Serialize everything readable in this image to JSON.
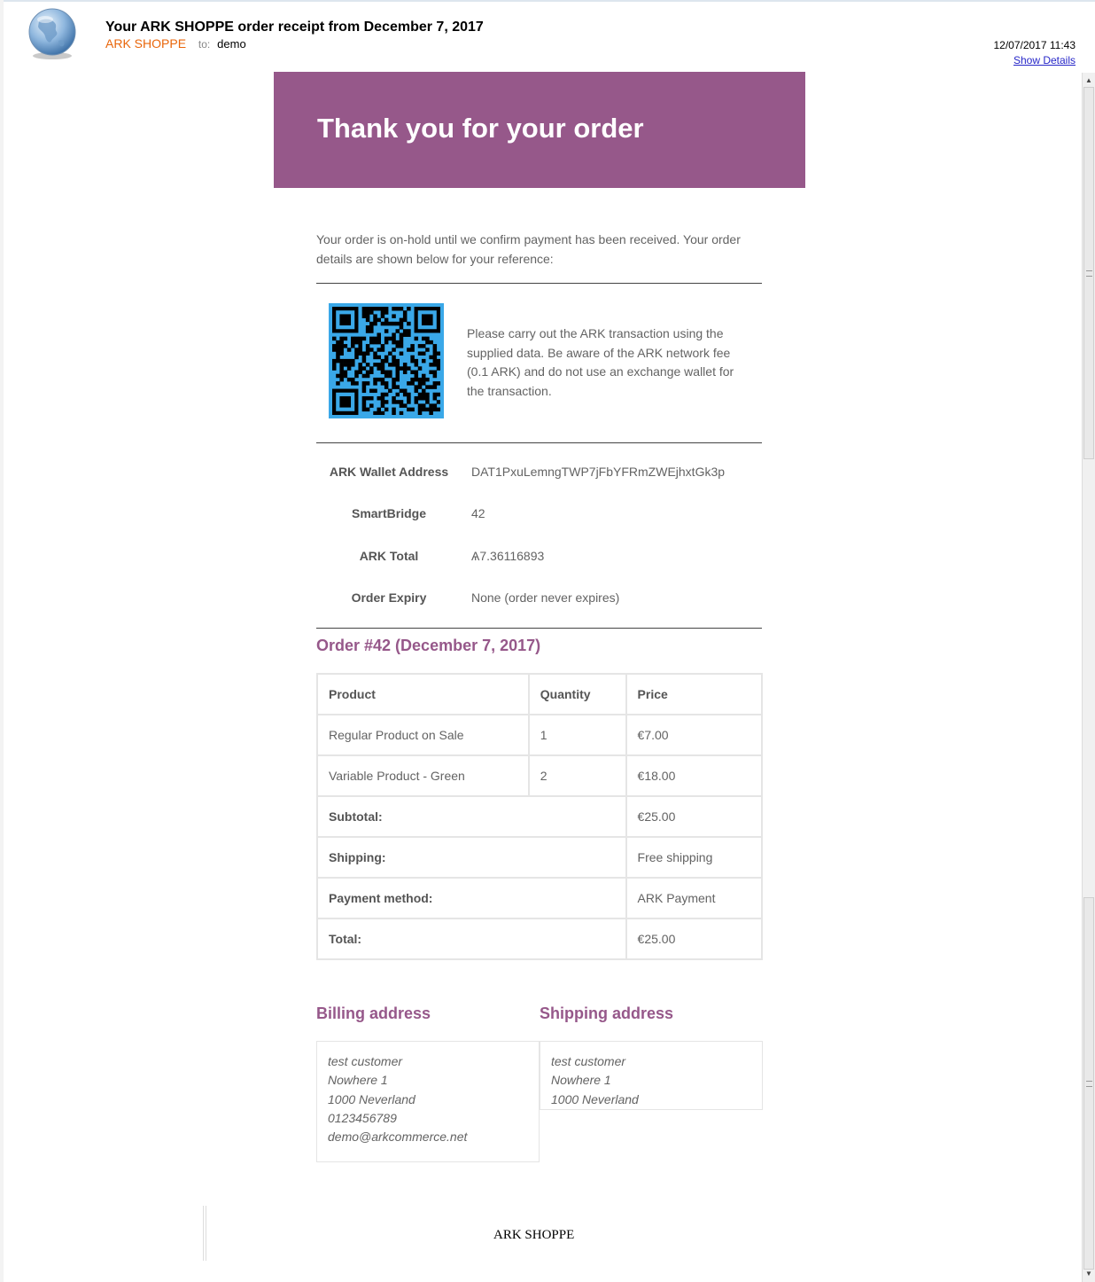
{
  "email": {
    "subject": "Your ARK SHOPPE order receipt from December 7, 2017",
    "from": "ARK SHOPPE",
    "to_label": "to:",
    "to": "demo",
    "date": "12/07/2017 11:43",
    "show_details": "Show Details"
  },
  "banner": {
    "heading": "Thank you for your order",
    "color": "#96588a"
  },
  "intro": "Your order is on-hold until we confirm payment has been received. Your order details are shown below for your reference:",
  "payment_note": "Please carry out the ARK transaction using the supplied data. Be aware of the ARK network fee (0.1 ARK) and do not use an exchange wallet for the transaction.",
  "payment_info": [
    {
      "label": "ARK Wallet Address",
      "value": "DAT1PxuLemngTWP7jFbYFRmZWEjhxtGk3p"
    },
    {
      "label": "SmartBridge",
      "value": "42"
    },
    {
      "label": "ARK Total",
      "value": "Ѧ7.36116893"
    },
    {
      "label": "Order Expiry",
      "value": "None (order never expires)"
    }
  ],
  "order": {
    "title": "Order #42 (December 7, 2017)",
    "headers": {
      "product": "Product",
      "quantity": "Quantity",
      "price": "Price"
    },
    "items": [
      {
        "product": "Regular Product on Sale",
        "quantity": "1",
        "price": "€7.00"
      },
      {
        "product": "Variable Product - Green",
        "quantity": "2",
        "price": "€18.00"
      }
    ],
    "totals": [
      {
        "label": "Subtotal:",
        "value": "€25.00"
      },
      {
        "label": "Shipping:",
        "value": "Free shipping"
      },
      {
        "label": "Payment method:",
        "value": "ARK Payment"
      },
      {
        "label": "Total:",
        "value": "€25.00"
      }
    ]
  },
  "billing": {
    "title": "Billing address",
    "lines": [
      "test customer",
      "Nowhere 1",
      "1000 Neverland",
      "0123456789",
      "demo@arkcommerce.net"
    ]
  },
  "shipping": {
    "title": "Shipping address",
    "lines": [
      "test customer",
      "Nowhere 1",
      "1000 Neverland"
    ]
  },
  "footer": "ARK SHOPPE"
}
